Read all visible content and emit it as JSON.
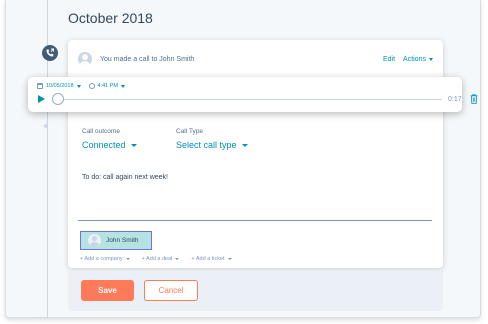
{
  "timeline": {
    "month": "October 2018"
  },
  "activity": {
    "header_text": "You made a call to John Smith",
    "edit_label": "Edit",
    "actions_label": "Actions"
  },
  "recording": {
    "date": "10/05/2018",
    "time": "4:41 PM",
    "duration": "0:17",
    "progress": 0
  },
  "fields": {
    "outcome_label": "Call outcome",
    "outcome_value": "Connected",
    "type_label": "Call Type",
    "type_value": "Select call type"
  },
  "note": "To do: call again next week!",
  "contact": {
    "name": "John Smith"
  },
  "associations": {
    "add_company": "+ Add a company",
    "add_deal": "+ Add a deal",
    "add_ticket": "+ Add a ticket"
  },
  "buttons": {
    "save": "Save",
    "cancel": "Cancel"
  },
  "colors": {
    "accent": "#0091ae",
    "primary_button": "#ff7a59",
    "contact_chip_bg": "#b5e3e3",
    "contact_chip_border": "#6a78d1",
    "timeline_badge": "#425b76"
  }
}
